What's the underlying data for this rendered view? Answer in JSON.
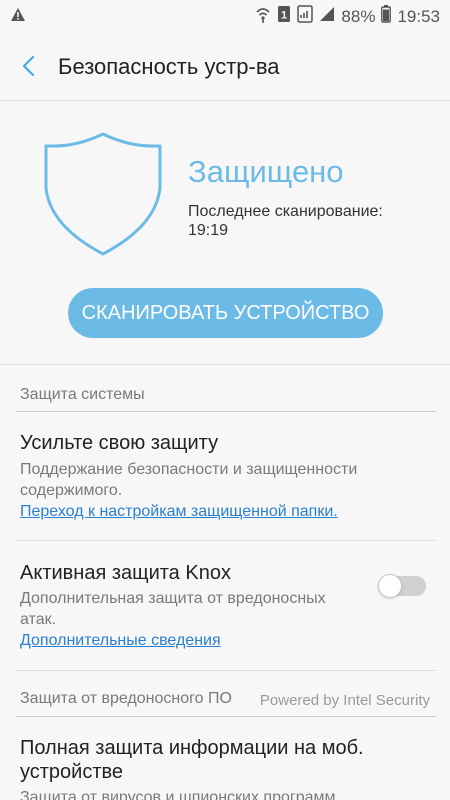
{
  "status_bar": {
    "battery": "88%",
    "time": "19:53",
    "icons": [
      "warning-icon",
      "wifi-icon",
      "sim-one-icon",
      "sim-card-icon",
      "signal-icon",
      "battery-icon"
    ]
  },
  "app_bar": {
    "title": "Безопасность устр-ва",
    "back_icon": "chevron-left-icon"
  },
  "hero": {
    "status": "Защищено",
    "last_scan_label": "Последнее сканирование:",
    "last_scan_time": "19:19",
    "scan_button": "СКАНИРОВАТЬ УСТРОЙСТВО",
    "shield_icon": "shield-icon"
  },
  "system_protection": {
    "header": "Защита системы",
    "items": [
      {
        "title": "Усильте свою защиту",
        "desc_line1": "Поддержание безопасности и защищенности",
        "desc_line2": "содержимого.",
        "link": "Переход к настройкам защищенной папки."
      },
      {
        "title": "Активная защита Knox",
        "desc_line1": "Дополнительная защита от вредоносных",
        "desc_line2": "атак.",
        "link": "Дополнительные сведения",
        "toggle_on": false
      }
    ]
  },
  "malware_protection": {
    "header": "Защита от вредоносного ПО",
    "powered_by": "Powered by Intel Security",
    "items": [
      {
        "title_line1": "Полная защита информации на моб.",
        "title_line2": "устройстве",
        "desc_line1": "Защита от вирусов и шпионских программ"
      }
    ]
  },
  "colors": {
    "accent": "#6cbbe6",
    "link": "#2a7fd0",
    "background": "#f7f7f7"
  }
}
